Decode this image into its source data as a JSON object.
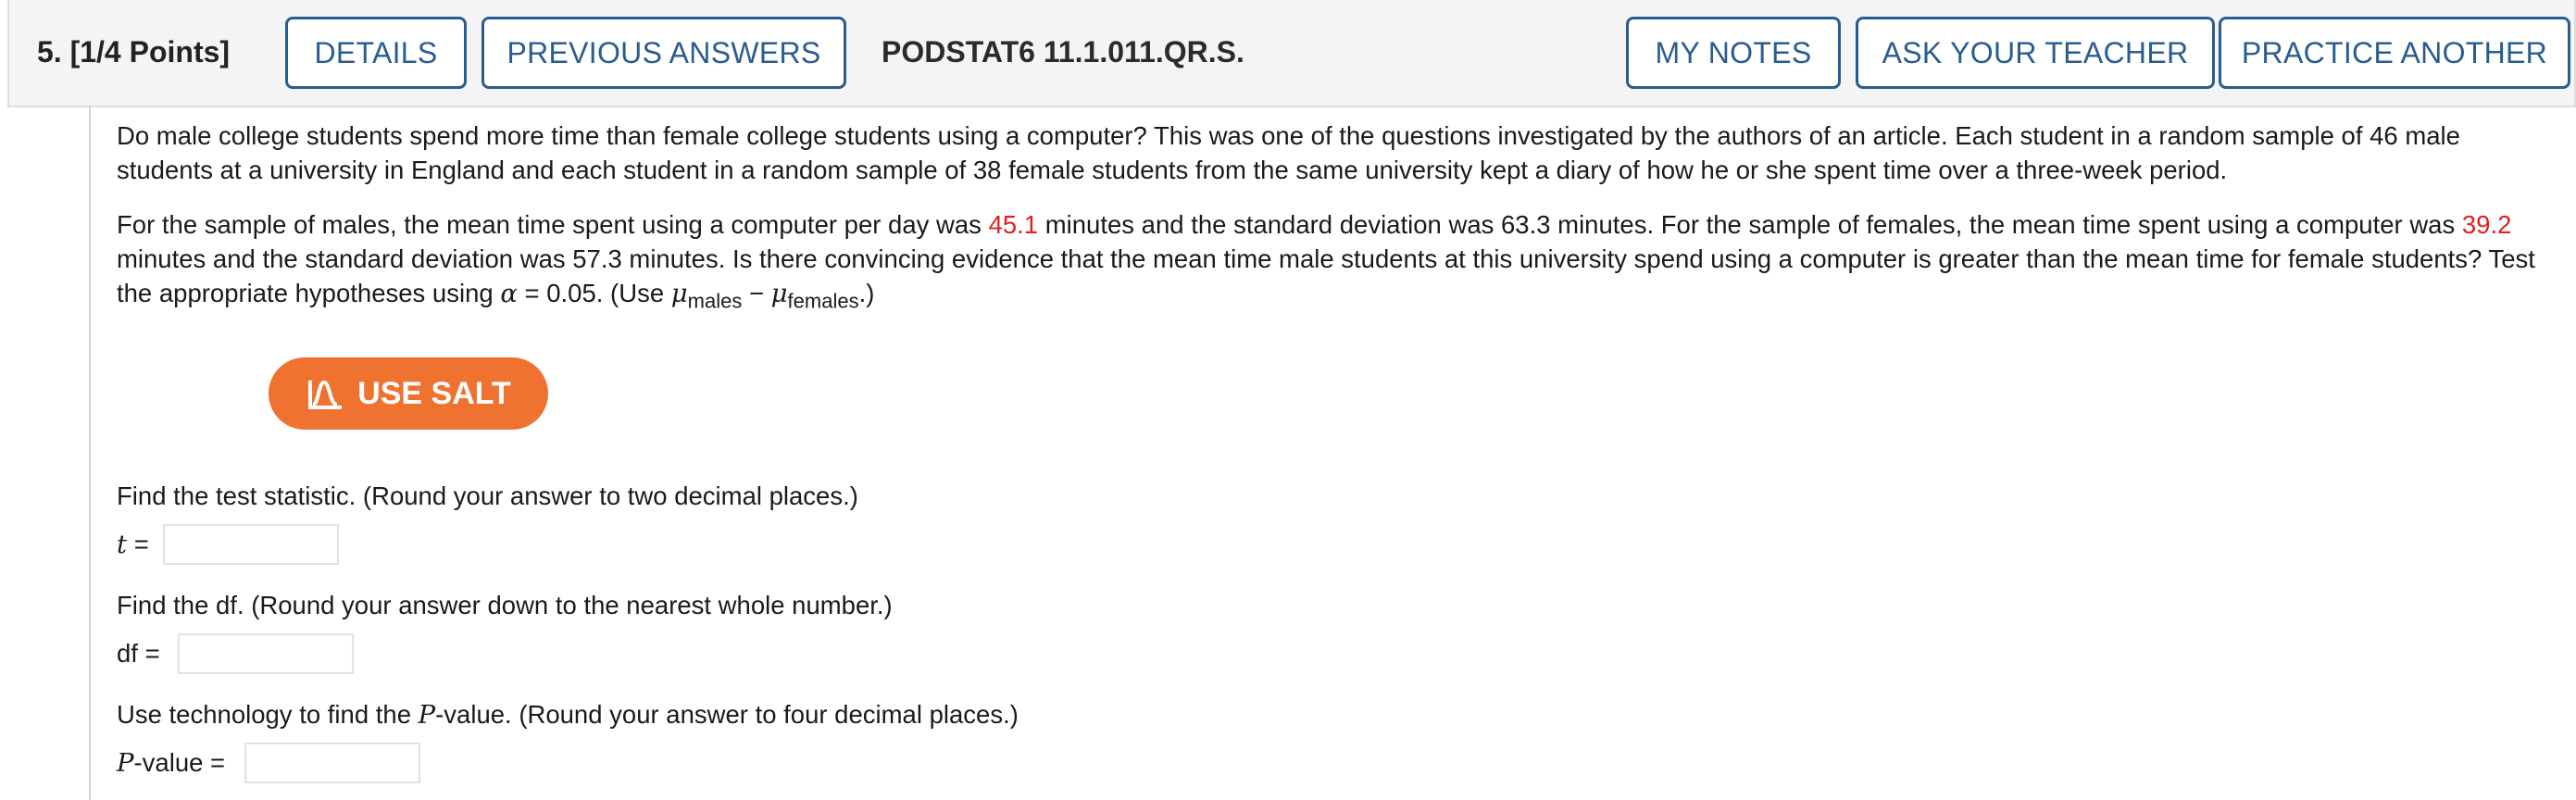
{
  "header": {
    "question_label": "5. [1/4 Points]",
    "details_label": "DETAILS",
    "previous_answers_label": "PREVIOUS ANSWERS",
    "problem_code": "PODSTAT6 11.1.011.QR.S.",
    "my_notes_label": "MY NOTES",
    "ask_teacher_label": "ASK YOUR TEACHER",
    "practice_another_label": "PRACTICE ANOTHER"
  },
  "intro": {
    "text": "Do male college students spend more time than female college students using a computer? This was one of the questions investigated by the authors of an article. Each student in a random sample of 46 male students at a university in England and each student in a random sample of 38 female students from the same university kept a diary of how he or she spent time over a three-week period."
  },
  "problem": {
    "p1": "For the sample of males, the mean time spent using a computer per day was ",
    "male_mean": "45.1",
    "p2": " minutes and the standard deviation was 63.3 minutes. For the sample of females, the mean time spent using a computer was ",
    "female_mean": "39.2",
    "p3": " minutes and the standard deviation was 57.3 minutes. Is there convincing evidence that the mean time male students at this university spend using a computer is greater than the mean time for female students? Test the appropriate hypotheses using ",
    "alpha_symbol": "α",
    "alpha_value": " = 0.05. (Use ",
    "mu_symbol": "μ",
    "males_sub": "males",
    "minus": " − ",
    "mu_symbol2": "μ",
    "females_sub": "females",
    "end": ".)"
  },
  "salt_button": {
    "label": "USE SALT",
    "color": "#ef7230",
    "icon": "chart-curve-icon"
  },
  "questions": {
    "test_stat_prompt": "Find the test statistic. (Round your answer to two decimal places.)",
    "t_label_var": "t",
    "t_label_eq": " =",
    "t_value": "",
    "df_prompt": "Find the df. (Round your answer down to the nearest whole number.)",
    "df_label": "df  =",
    "df_value": "",
    "p_prompt_pre": "Use technology to find the ",
    "p_prompt_var": "P",
    "p_prompt_post": "-value. (Round your answer to four decimal places.)",
    "p_label_var": "P",
    "p_label_rest": "-value =",
    "p_value": ""
  },
  "colors": {
    "accent": "#2a5d8f",
    "highlight": "#e02020"
  }
}
